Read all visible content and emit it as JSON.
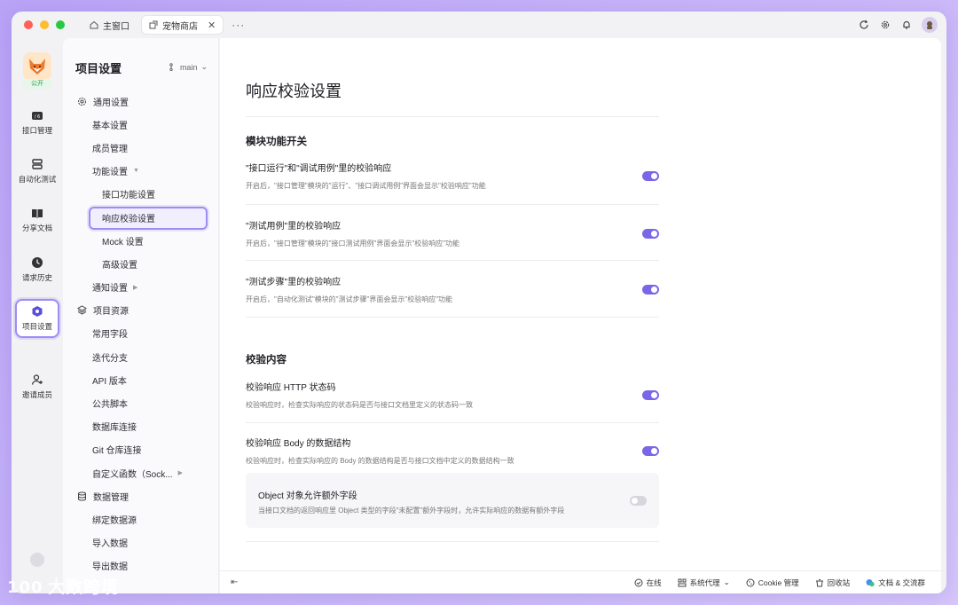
{
  "tabs": [
    {
      "label": "主窗口",
      "icon": "home-icon"
    },
    {
      "label": "宠物商店",
      "icon": "link-icon",
      "active": true
    }
  ],
  "titlebar": {
    "more": "···"
  },
  "rail": {
    "badge": "公开",
    "items": [
      {
        "label": "接口管理",
        "icon": "api-icon"
      },
      {
        "label": "自动化测试",
        "icon": "stack-icon"
      },
      {
        "label": "分享文档",
        "icon": "book-icon"
      },
      {
        "label": "请求历史",
        "icon": "clock-icon"
      },
      {
        "label": "项目设置",
        "icon": "settings-icon",
        "active": true
      },
      {
        "label": "邀请成员",
        "icon": "add-user-icon"
      }
    ]
  },
  "sidebar": {
    "title": "项目设置",
    "branch": "main",
    "items": [
      {
        "label": "通用设置",
        "level": 0,
        "icon": "gear-icon"
      },
      {
        "label": "基本设置",
        "level": 1
      },
      {
        "label": "成员管理",
        "level": 1
      },
      {
        "label": "功能设置",
        "level": 1,
        "arrow": "▼"
      },
      {
        "label": "接口功能设置",
        "level": 2
      },
      {
        "label": "响应校验设置",
        "level": 2,
        "selected": true
      },
      {
        "label": "Mock 设置",
        "level": 2
      },
      {
        "label": "高级设置",
        "level": 2
      },
      {
        "label": "通知设置",
        "level": 1,
        "arrow": "▶"
      },
      {
        "label": "项目资源",
        "level": 0,
        "icon": "layers-icon"
      },
      {
        "label": "常用字段",
        "level": 1
      },
      {
        "label": "迭代分支",
        "level": 1
      },
      {
        "label": "API 版本",
        "level": 1
      },
      {
        "label": "公共脚本",
        "level": 1
      },
      {
        "label": "数据库连接",
        "level": 1
      },
      {
        "label": "Git 仓库连接",
        "level": 1
      },
      {
        "label": "自定义函数（Sock...",
        "level": 1,
        "arrow": "▶"
      },
      {
        "label": "数据管理",
        "level": 0,
        "icon": "database-icon"
      },
      {
        "label": "绑定数据源",
        "level": 1
      },
      {
        "label": "导入数据",
        "level": 1
      },
      {
        "label": "导出数据",
        "level": 1
      }
    ]
  },
  "main": {
    "title": "响应校验设置",
    "section1": {
      "title": "模块功能开关",
      "settings": [
        {
          "title": "\"接口运行\"和\"调试用例\"里的校验响应",
          "desc": "开启后，\"接口管理\"模块的\"运行\"、\"接口调试用例\"界面会显示\"校验响应\"功能",
          "on": true
        },
        {
          "title": "\"测试用例\"里的校验响应",
          "desc": "开启后，\"接口管理\"模块的\"接口测试用例\"界面会显示\"校验响应\"功能",
          "on": true
        },
        {
          "title": "\"测试步骤\"里的校验响应",
          "desc": "开启后，\"自动化测试\"模块的\"测试步骤\"界面会显示\"校验响应\"功能",
          "on": true
        }
      ]
    },
    "section2": {
      "title": "校验内容",
      "settings": [
        {
          "title": "校验响应 HTTP 状态码",
          "desc": "校验响应时，检查实际响应的状态码是否与接口文档里定义的状态码一致",
          "on": true
        },
        {
          "title": "校验响应 Body 的数据结构",
          "desc": "校验响应时，检查实际响应的 Body 的数据结构是否与接口文档中定义的数据结构一致",
          "on": true
        }
      ],
      "sub": {
        "title": "Object 对象允许额外字段",
        "desc": "当接口文档的返回响应里 Object 类型的字段\"未配置\"额外字段时，允许实际响应的数据有额外字段",
        "on": false
      }
    }
  },
  "footer": {
    "collapse": "⇤",
    "items": [
      {
        "label": "在线",
        "icon": "online-icon"
      },
      {
        "label": "系统代理",
        "icon": "proxy-icon",
        "caret": "⌄"
      },
      {
        "label": "Cookie 管理",
        "icon": "cookie-icon"
      },
      {
        "label": "回收站",
        "icon": "trash-icon"
      },
      {
        "label": "文档 & 交流群",
        "icon": "chat-icon"
      }
    ]
  },
  "watermark": "大数跨境",
  "colors": {
    "accent": "#7a67e8",
    "highlight": "#9c8df5"
  }
}
